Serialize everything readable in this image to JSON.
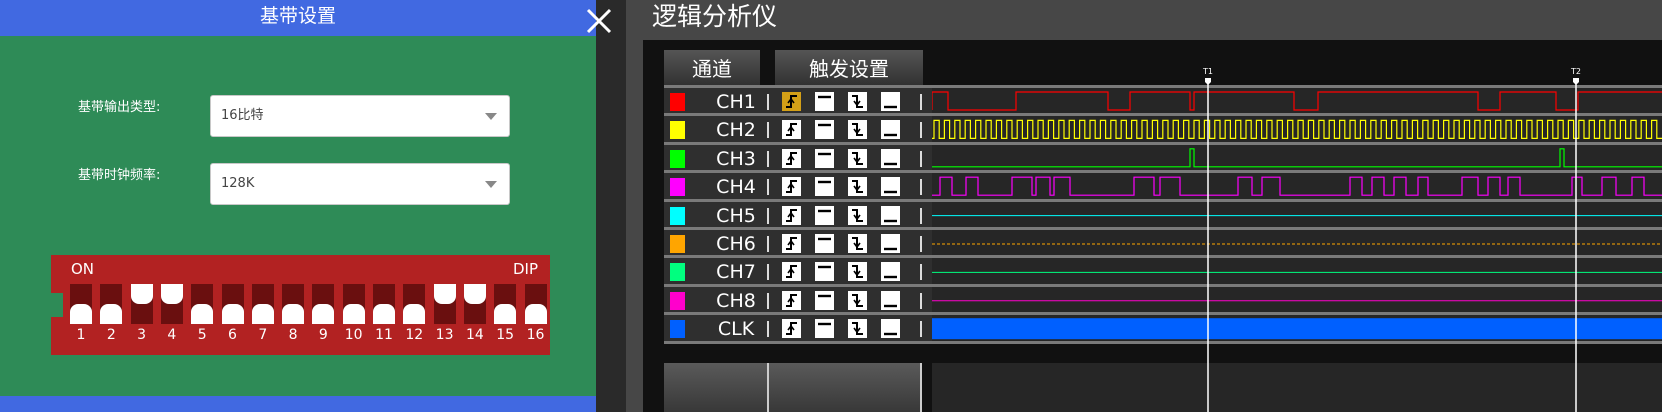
{
  "settings_dialog": {
    "title": "基带设置",
    "close_icon": "close-icon",
    "output_type": {
      "label": "基带输出类型:",
      "value": "16比特"
    },
    "clock_freq": {
      "label": "基带时钟频率:",
      "value": "128K"
    },
    "dip": {
      "on_label": "ON",
      "dip_label": "DIP",
      "switches": [
        {
          "num": "1",
          "on": false
        },
        {
          "num": "2",
          "on": false
        },
        {
          "num": "3",
          "on": true
        },
        {
          "num": "4",
          "on": true
        },
        {
          "num": "5",
          "on": false
        },
        {
          "num": "6",
          "on": false
        },
        {
          "num": "7",
          "on": false
        },
        {
          "num": "8",
          "on": false
        },
        {
          "num": "9",
          "on": false
        },
        {
          "num": "10",
          "on": false
        },
        {
          "num": "11",
          "on": false
        },
        {
          "num": "12",
          "on": false
        },
        {
          "num": "13",
          "on": true
        },
        {
          "num": "14",
          "on": true
        },
        {
          "num": "15",
          "on": false
        },
        {
          "num": "16",
          "on": false
        }
      ]
    }
  },
  "analyzer": {
    "title": "逻辑分析仪",
    "tabs": {
      "channels": "通道",
      "trigger": "触发设置"
    },
    "markers": {
      "t1": "T1",
      "t2": "T2"
    },
    "trigger_icons": [
      "rising-edge-icon",
      "high-level-icon",
      "falling-edge-icon",
      "low-level-icon"
    ],
    "channels": [
      {
        "name": "CH1",
        "color": "#ff0000",
        "active_trigger": 0
      },
      {
        "name": "CH2",
        "color": "#ffff00",
        "active_trigger": -1
      },
      {
        "name": "CH3",
        "color": "#00ff00",
        "active_trigger": -1
      },
      {
        "name": "CH4",
        "color": "#ff00ff",
        "active_trigger": -1
      },
      {
        "name": "CH5",
        "color": "#00ffff",
        "active_trigger": -1
      },
      {
        "name": "CH6",
        "color": "#ffa500",
        "active_trigger": -1
      },
      {
        "name": "CH7",
        "color": "#00ff7f",
        "active_trigger": -1
      },
      {
        "name": "CH8",
        "color": "#ff00cc",
        "active_trigger": -1
      },
      {
        "name": "CLK",
        "color": "#0060ff",
        "active_trigger": -1
      }
    ]
  }
}
